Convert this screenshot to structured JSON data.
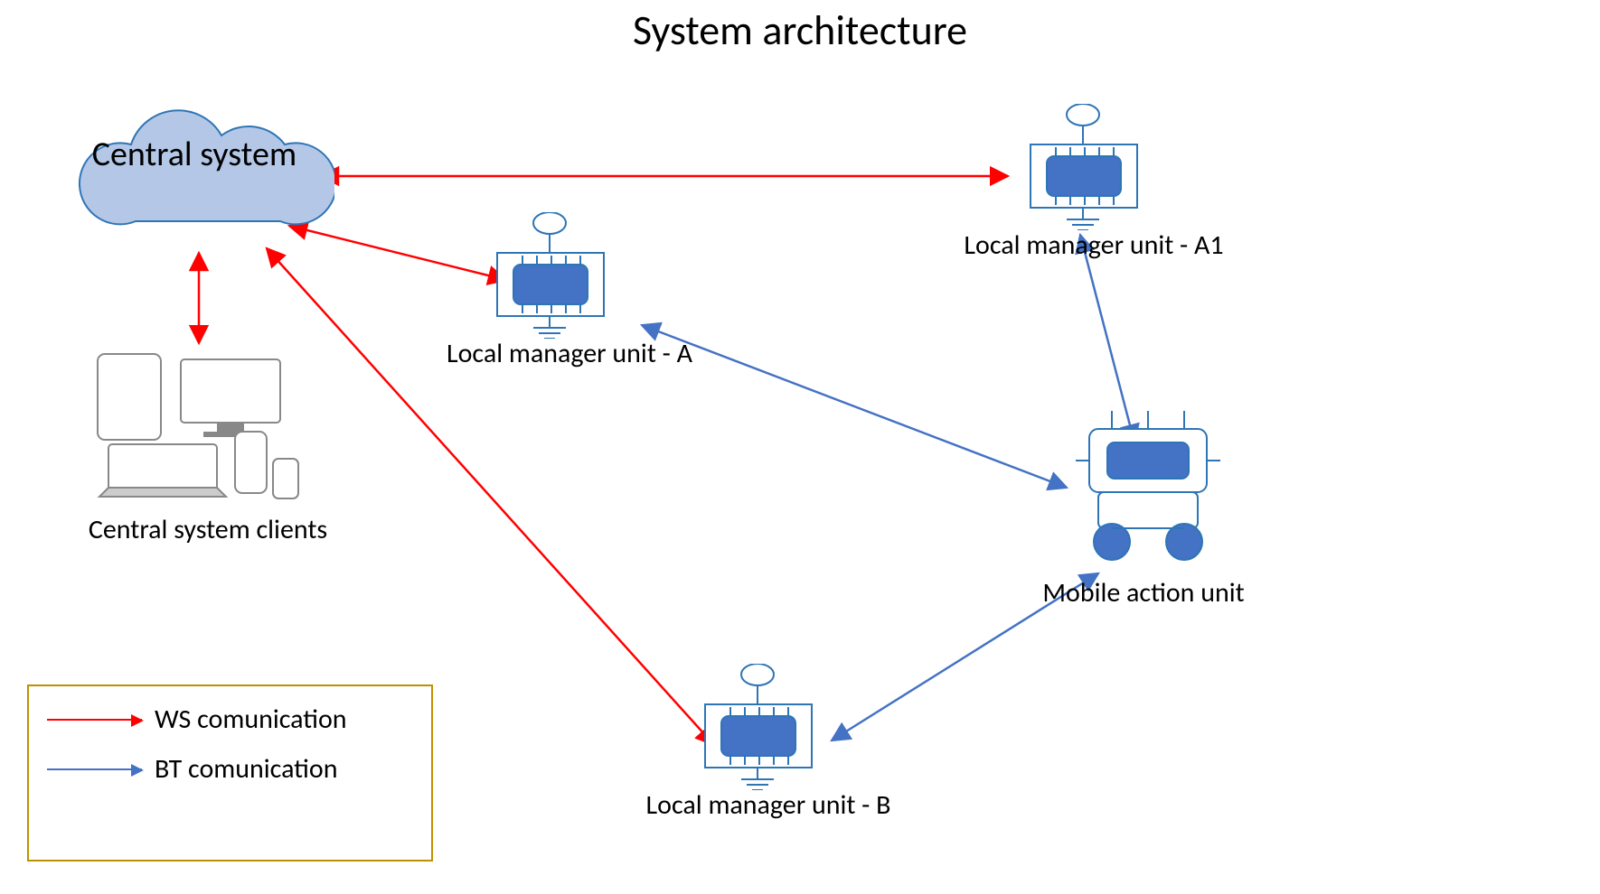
{
  "title": "System architecture",
  "cloud_label": "Central system",
  "nodes": {
    "a1": "Local manager unit - A1",
    "a": "Local manager unit - A",
    "b": "Local manager unit - B",
    "mobile": "Mobile action unit"
  },
  "devices_label": "Central system clients",
  "legend": {
    "ws": "WS comunication",
    "bt": "BT comunication"
  }
}
